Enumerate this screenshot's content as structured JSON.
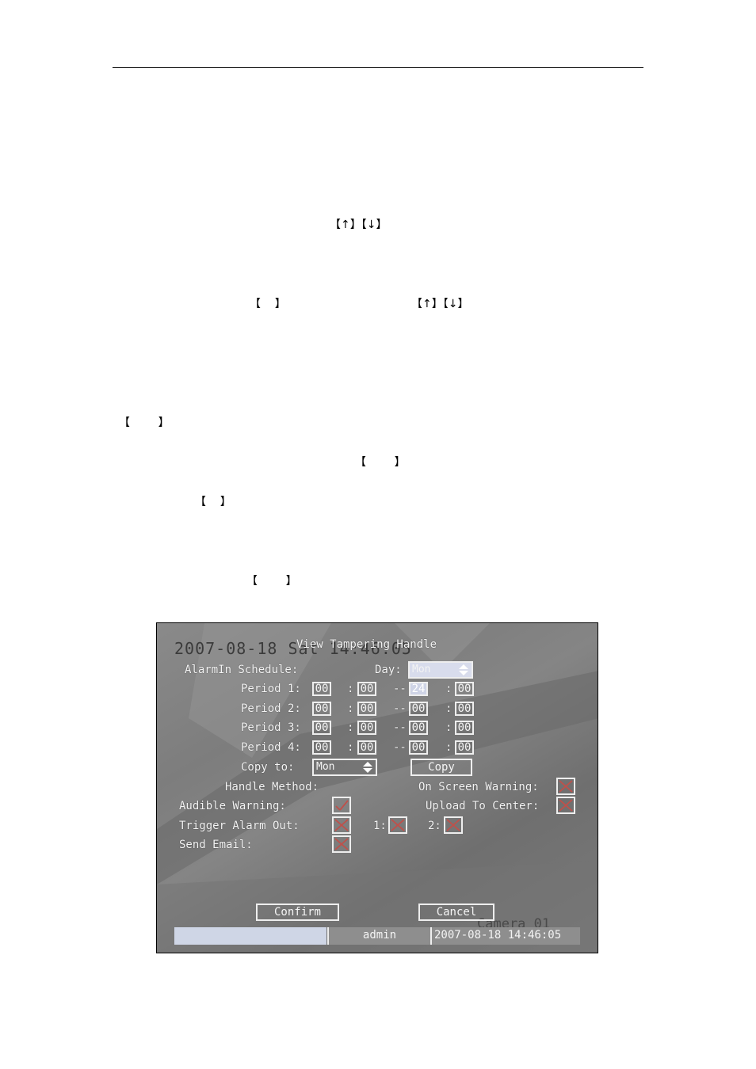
{
  "doc": {
    "fragments": {
      "arrows_a": "【↑】【↓】",
      "bracket_b": "【    】",
      "arrows_c": "【↑】【↓】",
      "bracket_d": "【        】",
      "bracket_e": "【        】",
      "bracket_f": "【    】",
      "bracket_g": "【        】"
    }
  },
  "osd": {
    "title": "View Tampering Handle",
    "overlay_timestamp": "2007-08-18 Sat 14:46:05",
    "overlay_camera": "Camera 01",
    "schedule_label": "AlarmIn Schedule:",
    "day_label": "Day:",
    "day_value": "Mon",
    "periods": [
      {
        "label": "Period 1:",
        "start_h": "00",
        "start_m": "00",
        "end_h": "24",
        "end_m": "00"
      },
      {
        "label": "Period 2:",
        "start_h": "00",
        "start_m": "00",
        "end_h": "00",
        "end_m": "00"
      },
      {
        "label": "Period 3:",
        "start_h": "00",
        "start_m": "00",
        "end_h": "00",
        "end_m": "00"
      },
      {
        "label": "Period 4:",
        "start_h": "00",
        "start_m": "00",
        "end_h": "00",
        "end_m": "00"
      }
    ],
    "sep_colon": ":",
    "sep_dash": "--",
    "copy_to_label": "Copy to:",
    "copy_to_value": "Mon",
    "copy_button": "Copy",
    "handle_method_label": "Handle Method:",
    "on_screen_warning_label": "On Screen Warning:",
    "audible_warning_label": "Audible Warning:",
    "upload_to_center_label": "Upload To Center:",
    "trigger_alarm_out_label": "Trigger Alarm Out:",
    "alarm_out_1_label": "1:",
    "alarm_out_2_label": "2:",
    "send_email_label": "Send Email:",
    "checks": {
      "on_screen_warning": false,
      "audible_warning": true,
      "upload_to_center": false,
      "trigger_alarm_out": false,
      "alarm_out_1": false,
      "alarm_out_2": false,
      "send_email": false
    },
    "confirm_button": "Confirm",
    "cancel_button": "Cancel",
    "status_user": "admin",
    "status_datetime": "2007-08-18 14:46:05",
    "colors": {
      "checkbox_mark": "#c0504a",
      "highlight": "#d4d8ea",
      "status_bar": "#cfd6e6"
    }
  }
}
